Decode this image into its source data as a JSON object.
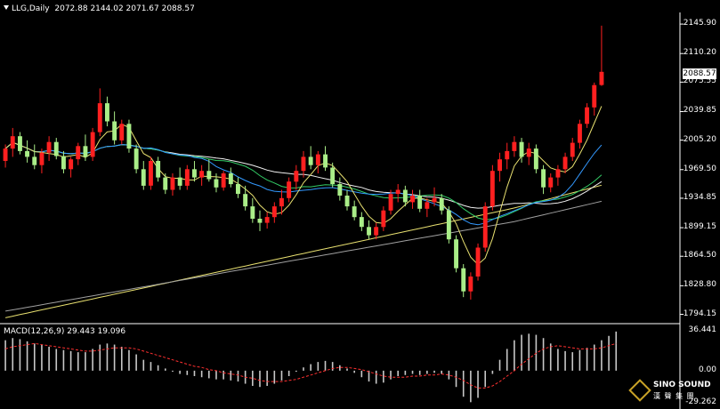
{
  "header": {
    "symbol": "LLG,Daily",
    "ohlc": "2072.88 2144.02 2071.67 2088.57"
  },
  "current_price": "2088.57",
  "price_axis": [
    "2145.90",
    "2110.20",
    "2075.55",
    "2039.85",
    "2005.20",
    "1969.50",
    "1934.85",
    "1899.15",
    "1864.50",
    "1828.80",
    "1794.15"
  ],
  "macd": {
    "label": "MACD(12,26,9) 29.443 19.096",
    "axis": [
      "36.441",
      "0.00",
      "-29.262"
    ]
  },
  "logo": {
    "brand": "SINO SOUND",
    "cn": "漢 聲 集 團",
    "icon": "diamond-logo-icon"
  },
  "colors": {
    "up": "#ff2020",
    "down": "#aaee88",
    "ma_yellow": "#e8e070",
    "ma_blue": "#3399ff",
    "ma_green": "#33cc66",
    "ma_white": "#f0f0f0",
    "ma_gray": "#a0a0a0",
    "signal": "#ff3030"
  },
  "chart_data": {
    "type": "candlestick",
    "ylim": [
      1785,
      2160
    ],
    "macd_ylim": [
      -32,
      40
    ],
    "candles": [
      [
        1980,
        2000,
        1972,
        1995
      ],
      [
        1995,
        2020,
        1985,
        2010
      ],
      [
        2010,
        2015,
        1988,
        1992
      ],
      [
        1992,
        2005,
        1978,
        1985
      ],
      [
        1985,
        2000,
        1970,
        1975
      ],
      [
        1975,
        1995,
        1965,
        1990
      ],
      [
        1990,
        2010,
        1980,
        2003
      ],
      [
        2003,
        2008,
        1982,
        1986
      ],
      [
        1986,
        1992,
        1965,
        1970
      ],
      [
        1970,
        1985,
        1960,
        1982
      ],
      [
        1982,
        2002,
        1975,
        1998
      ],
      [
        1998,
        2012,
        1980,
        1985
      ],
      [
        1985,
        2020,
        1980,
        2015
      ],
      [
        2015,
        2068,
        2010,
        2050
      ],
      [
        2050,
        2058,
        2022,
        2028
      ],
      [
        2028,
        2040,
        2000,
        2005
      ],
      [
        2005,
        2030,
        2000,
        2025
      ],
      [
        2025,
        2030,
        1990,
        1995
      ],
      [
        1995,
        2000,
        1965,
        1970
      ],
      [
        1970,
        1980,
        1945,
        1950
      ],
      [
        1950,
        1985,
        1945,
        1980
      ],
      [
        1980,
        1985,
        1955,
        1960
      ],
      [
        1960,
        1965,
        1940,
        1945
      ],
      [
        1945,
        1965,
        1938,
        1960
      ],
      [
        1960,
        1972,
        1945,
        1950
      ],
      [
        1950,
        1975,
        1945,
        1970
      ],
      [
        1970,
        1980,
        1955,
        1960
      ],
      [
        1960,
        1975,
        1950,
        1968
      ],
      [
        1968,
        1982,
        1955,
        1958
      ],
      [
        1958,
        1965,
        1942,
        1948
      ],
      [
        1948,
        1968,
        1944,
        1965
      ],
      [
        1965,
        1972,
        1948,
        1952
      ],
      [
        1952,
        1960,
        1935,
        1940
      ],
      [
        1940,
        1950,
        1920,
        1925
      ],
      [
        1925,
        1935,
        1905,
        1910
      ],
      [
        1910,
        1920,
        1895,
        1905
      ],
      [
        1905,
        1918,
        1898,
        1912
      ],
      [
        1912,
        1930,
        1905,
        1925
      ],
      [
        1925,
        1945,
        1915,
        1935
      ],
      [
        1935,
        1960,
        1930,
        1955
      ],
      [
        1955,
        1975,
        1945,
        1968
      ],
      [
        1968,
        1992,
        1960,
        1985
      ],
      [
        1985,
        1998,
        1970,
        1975
      ],
      [
        1975,
        1992,
        1965,
        1988
      ],
      [
        1988,
        1998,
        1968,
        1972
      ],
      [
        1972,
        1978,
        1948,
        1952
      ],
      [
        1952,
        1960,
        1932,
        1938
      ],
      [
        1938,
        1945,
        1920,
        1925
      ],
      [
        1925,
        1932,
        1908,
        1912
      ],
      [
        1912,
        1918,
        1895,
        1900
      ],
      [
        1900,
        1908,
        1885,
        1890
      ],
      [
        1890,
        1905,
        1885,
        1900
      ],
      [
        1900,
        1925,
        1895,
        1920
      ],
      [
        1920,
        1945,
        1915,
        1940
      ],
      [
        1940,
        1952,
        1930,
        1945
      ],
      [
        1945,
        1950,
        1925,
        1930
      ],
      [
        1930,
        1945,
        1922,
        1938
      ],
      [
        1938,
        1945,
        1918,
        1922
      ],
      [
        1922,
        1935,
        1912,
        1930
      ],
      [
        1930,
        1948,
        1925,
        1935
      ],
      [
        1935,
        1940,
        1915,
        1920
      ],
      [
        1920,
        1925,
        1880,
        1885
      ],
      [
        1885,
        1890,
        1845,
        1850
      ],
      [
        1850,
        1855,
        1815,
        1822
      ],
      [
        1822,
        1845,
        1812,
        1840
      ],
      [
        1840,
        1880,
        1835,
        1875
      ],
      [
        1875,
        1930,
        1870,
        1925
      ],
      [
        1925,
        1975,
        1920,
        1968
      ],
      [
        1968,
        1990,
        1955,
        1982
      ],
      [
        1982,
        2002,
        1970,
        1992
      ],
      [
        1992,
        2010,
        1985,
        2003
      ],
      [
        2003,
        2008,
        1978,
        1985
      ],
      [
        1985,
        2002,
        1975,
        1995
      ],
      [
        1995,
        2000,
        1965,
        1970
      ],
      [
        1970,
        1975,
        1940,
        1948
      ],
      [
        1948,
        1965,
        1942,
        1960
      ],
      [
        1960,
        1975,
        1950,
        1970
      ],
      [
        1970,
        1990,
        1965,
        1985
      ],
      [
        1985,
        2008,
        1980,
        2002
      ],
      [
        2002,
        2030,
        1995,
        2025
      ],
      [
        2025,
        2050,
        2020,
        2045
      ],
      [
        2045,
        2075,
        2035,
        2072
      ],
      [
        2072,
        2144,
        2071,
        2088
      ]
    ],
    "macd_hist": [
      28,
      30,
      29,
      27,
      25,
      24,
      22,
      20,
      19,
      18,
      17,
      17,
      20,
      24,
      25,
      24,
      22,
      19,
      15,
      10,
      8,
      5,
      2,
      -1,
      -3,
      -4,
      -5,
      -6,
      -7,
      -8,
      -8,
      -9,
      -10,
      -12,
      -14,
      -15,
      -14,
      -12,
      -9,
      -5,
      -1,
      3,
      6,
      8,
      9,
      8,
      5,
      2,
      -2,
      -6,
      -10,
      -12,
      -11,
      -8,
      -5,
      -4,
      -3,
      -4,
      -3,
      -2,
      -3,
      -8,
      -15,
      -24,
      -29,
      -25,
      -15,
      -3,
      10,
      20,
      28,
      33,
      34,
      33,
      30,
      25,
      20,
      18,
      17,
      19,
      21,
      24,
      28,
      32,
      36
    ],
    "macd_signal": [
      20,
      22,
      23,
      24,
      25,
      24,
      23,
      22,
      21,
      20,
      19,
      18,
      18,
      19,
      20,
      21,
      21,
      21,
      20,
      18,
      16,
      14,
      12,
      10,
      8,
      6,
      4,
      3,
      1,
      0,
      -2,
      -3,
      -4,
      -6,
      -7,
      -9,
      -10,
      -10,
      -10,
      -9,
      -8,
      -6,
      -4,
      -2,
      0,
      2,
      3,
      3,
      2,
      1,
      -1,
      -3,
      -5,
      -6,
      -6,
      -6,
      -5,
      -5,
      -4,
      -4,
      -3,
      -4,
      -6,
      -9,
      -13,
      -16,
      -16,
      -14,
      -10,
      -5,
      0,
      6,
      11,
      16,
      20,
      22,
      23,
      22,
      21,
      20,
      20,
      20,
      21,
      23,
      25
    ]
  }
}
